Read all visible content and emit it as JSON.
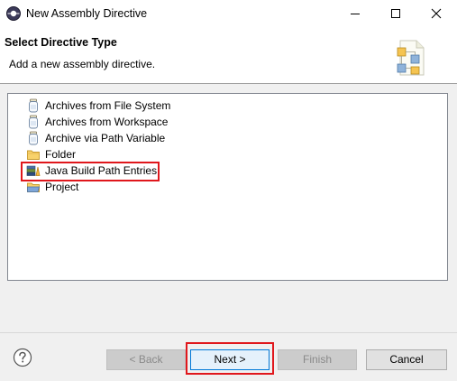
{
  "window": {
    "title": "New Assembly Directive",
    "icon": "eclipse-app-icon"
  },
  "banner": {
    "title": "Select Directive Type",
    "description": "Add a new assembly directive.",
    "icon": "wizard-banner-icon"
  },
  "tree": {
    "items": [
      {
        "label": "Archives from File System",
        "icon": "jar-icon"
      },
      {
        "label": "Archives from Workspace",
        "icon": "jar-icon"
      },
      {
        "label": "Archive via Path Variable",
        "icon": "jar-icon"
      },
      {
        "label": "Folder",
        "icon": "folder-icon"
      },
      {
        "label": "Java Build Path Entries",
        "icon": "library-icon",
        "highlighted": true
      },
      {
        "label": "Project",
        "icon": "project-folder-icon"
      }
    ]
  },
  "buttons": {
    "back": "< Back",
    "next": "Next >",
    "finish": "Finish",
    "cancel": "Cancel"
  },
  "colors": {
    "highlight": "#e0171c",
    "default_button_border": "#0078d7"
  }
}
